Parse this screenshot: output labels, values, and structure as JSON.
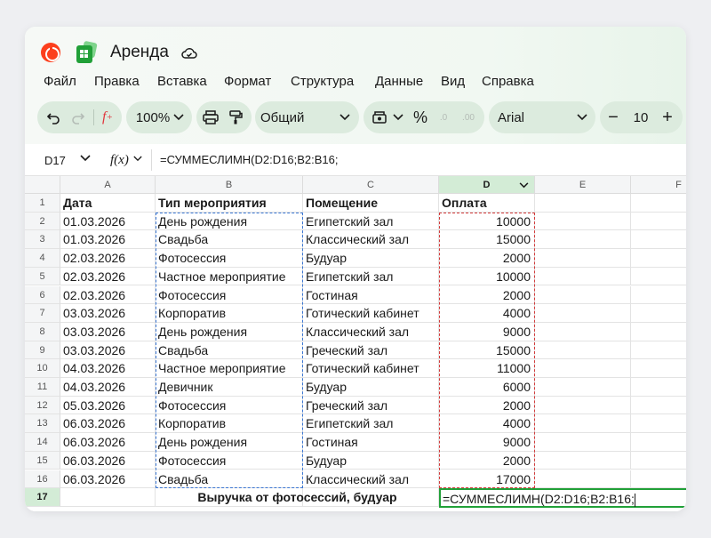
{
  "app": {
    "title": "Аренда",
    "icons": {
      "brand": "yandex-logo-icon",
      "app": "tables-app-icon",
      "save_status": "cloud-saved-icon"
    },
    "colors": {
      "accent": "#21a038",
      "toolbar_bg": "#dcebde",
      "range_blue": "#3b77d4",
      "range_red": "#d23b3b"
    }
  },
  "menu": [
    "Файл",
    "Правка",
    "Вставка",
    "Формат",
    "Структура",
    "Данные",
    "Вид",
    "Справка"
  ],
  "toolbar": {
    "zoom": "100%",
    "number_format": "Общий",
    "percent": "%",
    "font": "Arial",
    "font_size": "10",
    "minus": "−",
    "plus": "+",
    "decimal_dec": ".0",
    "decimal_inc": ".00"
  },
  "formula_bar": {
    "cell_ref": "D17",
    "fx_label": "f(x)",
    "formula": "=СУММЕСЛИМН(D2:D16;B2:B16;"
  },
  "sheet": {
    "columns": [
      "A",
      "B",
      "C",
      "D",
      "E",
      "F"
    ],
    "headers": [
      "Дата",
      "Тип мероприятия",
      "Помещение",
      "Оплата"
    ],
    "rows": [
      [
        "01.03.2026",
        "День рождения",
        "Египетский зал",
        "10000"
      ],
      [
        "01.03.2026",
        "Свадьба",
        "Классический зал",
        "15000"
      ],
      [
        "02.03.2026",
        "Фотосессия",
        "Будуар",
        "2000"
      ],
      [
        "02.03.2026",
        "Частное мероприятие",
        "Египетский зал",
        "10000"
      ],
      [
        "02.03.2026",
        "Фотосессия",
        "Гостиная",
        "2000"
      ],
      [
        "03.03.2026",
        "Корпоратив",
        "Готический кабинет",
        "4000"
      ],
      [
        "03.03.2026",
        "День рождения",
        "Классический зал",
        "9000"
      ],
      [
        "03.03.2026",
        "Свадьба",
        "Греческий зал",
        "15000"
      ],
      [
        "04.03.2026",
        "Частное мероприятие",
        "Готический кабинет",
        "11000"
      ],
      [
        "04.03.2026",
        "Девичник",
        "Будуар",
        "6000"
      ],
      [
        "05.03.2026",
        "Фотосессия",
        "Греческий зал",
        "2000"
      ],
      [
        "06.03.2026",
        "Корпоратив",
        "Египетский зал",
        "4000"
      ],
      [
        "06.03.2026",
        "День рождения",
        "Гостиная",
        "9000"
      ],
      [
        "06.03.2026",
        "Фотосессия",
        "Будуар",
        "2000"
      ],
      [
        "06.03.2026",
        "Свадьба",
        "Классический зал",
        "17000"
      ]
    ],
    "summary_label": "Выручка от фотосессий, будуар",
    "active_cell_text": "=СУММЕСЛИМН(D2:D16;B2:B16;"
  }
}
